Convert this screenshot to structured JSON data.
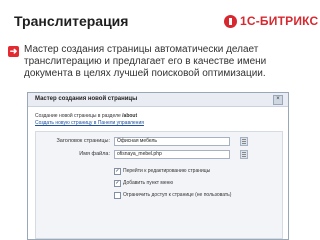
{
  "slide": {
    "title": "Транслитерация",
    "logo_text": "1С-БИТРИКС",
    "description": "Мастер создания страницы автоматически делает транслитерацию и предлагает его в качестве имени документа в целях лучшей поисковой оптимизации."
  },
  "dialog": {
    "title": "Мастер создания новой страницы",
    "info_line1_prefix": "Создание новой страницы в разделе ",
    "info_path": "/about",
    "info_link": "Создать новую страницу в Панели управления",
    "fields": {
      "header_label": "Заголовок страницы:",
      "header_value": "Офисная мебель",
      "filename_label": "Имя файла:",
      "filename_value": "ofisnaya_mebel.php"
    },
    "checkboxes": [
      {
        "label": "Перейти к редактированию страницы",
        "checked": true
      },
      {
        "label": "Добавить пункт меню",
        "checked": true
      },
      {
        "label": "Ограничить доступ к странице (не пользовать)",
        "checked": false
      }
    ]
  },
  "colors": {
    "accent": "#e32a31",
    "dialog_border": "#9aa7b8"
  },
  "icons": {
    "bullet": "arrow-right-icon",
    "logo": "bitrix-logo-icon",
    "close": "close-icon",
    "field_button": "list-icon"
  }
}
